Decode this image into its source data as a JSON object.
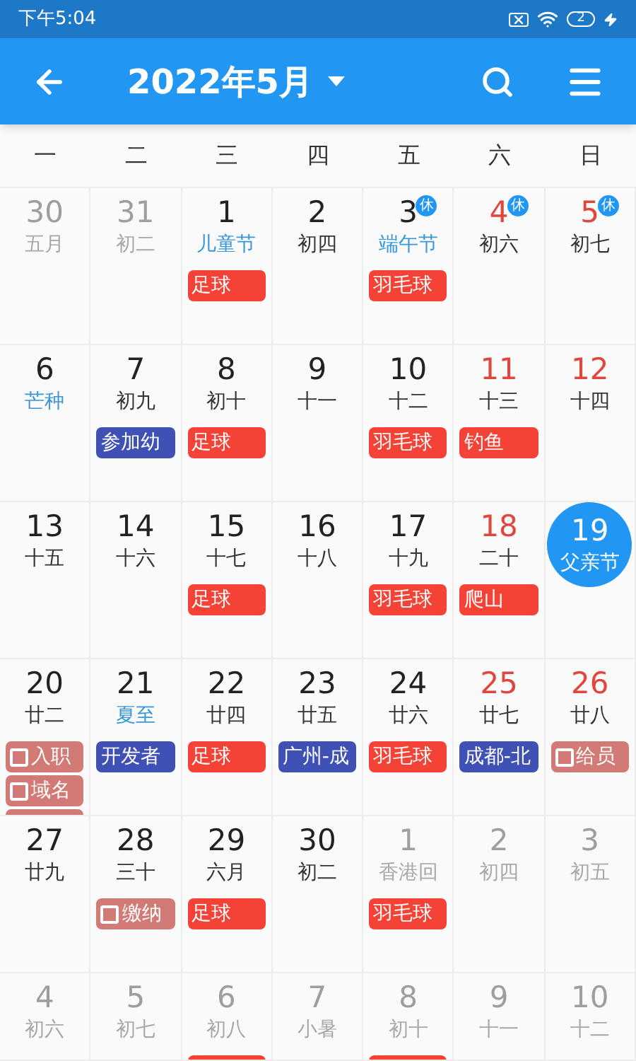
{
  "status_bar": {
    "time": "下午5:04",
    "battery": "2"
  },
  "app_bar": {
    "title": "2022年5月"
  },
  "weekdays": [
    "一",
    "二",
    "三",
    "四",
    "五",
    "六",
    "日"
  ],
  "weeks": [
    [
      {
        "day": "30",
        "lunar": "五月",
        "faded": true,
        "red": false,
        "festival": false,
        "selected": false
      },
      {
        "day": "31",
        "lunar": "初二",
        "faded": true,
        "red": false,
        "festival": false,
        "selected": false
      },
      {
        "day": "1",
        "lunar": "儿童节",
        "faded": false,
        "red": false,
        "festival": true,
        "selected": false,
        "events": [
          {
            "kind": "event",
            "label": "足球",
            "color": "#f44336"
          }
        ]
      },
      {
        "day": "2",
        "lunar": "初四",
        "faded": false,
        "red": false,
        "festival": false,
        "selected": false
      },
      {
        "day": "3",
        "lunar": "端午节",
        "faded": false,
        "red": false,
        "festival": true,
        "rest": "休",
        "selected": false,
        "events": [
          {
            "kind": "event",
            "label": "羽毛球",
            "color": "#f44336"
          }
        ]
      },
      {
        "day": "4",
        "lunar": "初六",
        "faded": false,
        "red": true,
        "festival": false,
        "rest": "休",
        "selected": false
      },
      {
        "day": "5",
        "lunar": "初七",
        "faded": false,
        "red": true,
        "festival": false,
        "rest": "休",
        "selected": false
      }
    ],
    [
      {
        "day": "6",
        "lunar": "芒种",
        "faded": false,
        "red": false,
        "festival": true,
        "selected": false
      },
      {
        "day": "7",
        "lunar": "初九",
        "faded": false,
        "red": false,
        "festival": false,
        "selected": false,
        "events": [
          {
            "kind": "event",
            "label": "参加幼",
            "color": "#3f51b5"
          }
        ]
      },
      {
        "day": "8",
        "lunar": "初十",
        "faded": false,
        "red": false,
        "festival": false,
        "selected": false,
        "events": [
          {
            "kind": "event",
            "label": "足球",
            "color": "#f44336"
          }
        ]
      },
      {
        "day": "9",
        "lunar": "十一",
        "faded": false,
        "red": false,
        "festival": false,
        "selected": false
      },
      {
        "day": "10",
        "lunar": "十二",
        "faded": false,
        "red": false,
        "festival": false,
        "selected": false,
        "events": [
          {
            "kind": "event",
            "label": "羽毛球",
            "color": "#f44336"
          }
        ]
      },
      {
        "day": "11",
        "lunar": "十三",
        "faded": false,
        "red": true,
        "festival": false,
        "selected": false,
        "events": [
          {
            "kind": "event",
            "label": "钓鱼",
            "color": "#f44336"
          }
        ]
      },
      {
        "day": "12",
        "lunar": "十四",
        "faded": false,
        "red": true,
        "festival": false,
        "selected": false
      }
    ],
    [
      {
        "day": "13",
        "lunar": "十五",
        "faded": false,
        "red": false,
        "festival": false,
        "selected": false
      },
      {
        "day": "14",
        "lunar": "十六",
        "faded": false,
        "red": false,
        "festival": false,
        "selected": false
      },
      {
        "day": "15",
        "lunar": "十七",
        "faded": false,
        "red": false,
        "festival": false,
        "selected": false,
        "events": [
          {
            "kind": "event",
            "label": "足球",
            "color": "#f44336"
          }
        ]
      },
      {
        "day": "16",
        "lunar": "十八",
        "faded": false,
        "red": false,
        "festival": false,
        "selected": false
      },
      {
        "day": "17",
        "lunar": "十九",
        "faded": false,
        "red": false,
        "festival": false,
        "selected": false,
        "events": [
          {
            "kind": "event",
            "label": "羽毛球",
            "color": "#f44336"
          }
        ]
      },
      {
        "day": "18",
        "lunar": "二十",
        "faded": false,
        "red": true,
        "festival": false,
        "selected": false,
        "events": [
          {
            "kind": "event",
            "label": "爬山",
            "color": "#f44336"
          }
        ]
      },
      {
        "day": "19",
        "lunar": "父亲节",
        "selected": true
      }
    ],
    [
      {
        "day": "20",
        "lunar": "廿二",
        "faded": false,
        "red": false,
        "festival": false,
        "selected": false,
        "more": true,
        "events": [
          {
            "kind": "todo",
            "label": "入职",
            "color": "#d27b76"
          },
          {
            "kind": "todo",
            "label": "域名",
            "color": "#d27b76"
          }
        ]
      },
      {
        "day": "21",
        "lunar": "夏至",
        "faded": false,
        "red": false,
        "festival": true,
        "selected": false,
        "events": [
          {
            "kind": "event",
            "label": "开发者",
            "color": "#3f51b5"
          }
        ]
      },
      {
        "day": "22",
        "lunar": "廿四",
        "faded": false,
        "red": false,
        "festival": false,
        "selected": false,
        "events": [
          {
            "kind": "event",
            "label": "足球",
            "color": "#f44336"
          }
        ]
      },
      {
        "day": "23",
        "lunar": "廿五",
        "faded": false,
        "red": false,
        "festival": false,
        "selected": false,
        "events": [
          {
            "kind": "event",
            "label": "广州-成",
            "color": "#3f51b5"
          }
        ]
      },
      {
        "day": "24",
        "lunar": "廿六",
        "faded": false,
        "red": false,
        "festival": false,
        "selected": false,
        "events": [
          {
            "kind": "event",
            "label": "羽毛球",
            "color": "#f44336"
          }
        ]
      },
      {
        "day": "25",
        "lunar": "廿七",
        "faded": false,
        "red": true,
        "festival": false,
        "selected": false,
        "events": [
          {
            "kind": "event",
            "label": "成都-北",
            "color": "#3f51b5"
          }
        ]
      },
      {
        "day": "26",
        "lunar": "廿八",
        "faded": false,
        "red": true,
        "festival": false,
        "selected": false,
        "events": [
          {
            "kind": "todo",
            "label": "给员",
            "color": "#d27b76"
          }
        ]
      }
    ],
    [
      {
        "day": "27",
        "lunar": "廿九",
        "faded": false,
        "red": false,
        "festival": false,
        "selected": false
      },
      {
        "day": "28",
        "lunar": "三十",
        "faded": false,
        "red": false,
        "festival": false,
        "selected": false,
        "events": [
          {
            "kind": "todo",
            "label": "缴纳",
            "color": "#d27b76"
          }
        ]
      },
      {
        "day": "29",
        "lunar": "六月",
        "faded": false,
        "red": false,
        "festival": false,
        "selected": false,
        "events": [
          {
            "kind": "event",
            "label": "足球",
            "color": "#f44336"
          }
        ]
      },
      {
        "day": "30",
        "lunar": "初二",
        "faded": false,
        "red": false,
        "festival": false,
        "selected": false
      },
      {
        "day": "1",
        "lunar": "香港回",
        "faded": true,
        "red": false,
        "festival": false,
        "selected": false,
        "events": [
          {
            "kind": "event",
            "label": "羽毛球",
            "color": "#f44336"
          }
        ]
      },
      {
        "day": "2",
        "lunar": "初四",
        "faded": true,
        "red": false,
        "festival": false,
        "selected": false
      },
      {
        "day": "3",
        "lunar": "初五",
        "faded": true,
        "red": false,
        "festival": false,
        "selected": false
      }
    ],
    [
      {
        "day": "4",
        "lunar": "初六",
        "faded": true,
        "red": false,
        "festival": false,
        "selected": false
      },
      {
        "day": "5",
        "lunar": "初七",
        "faded": true,
        "red": false,
        "festival": false,
        "selected": false
      },
      {
        "day": "6",
        "lunar": "初八",
        "faded": true,
        "red": false,
        "festival": false,
        "selected": false,
        "more": true
      },
      {
        "day": "7",
        "lunar": "小暑",
        "faded": true,
        "red": false,
        "festival": false,
        "selected": false
      },
      {
        "day": "8",
        "lunar": "初十",
        "faded": true,
        "red": false,
        "festival": false,
        "selected": false,
        "more": true
      },
      {
        "day": "9",
        "lunar": "十一",
        "faded": true,
        "red": false,
        "festival": false,
        "selected": false
      },
      {
        "day": "10",
        "lunar": "十二",
        "faded": true,
        "red": false,
        "festival": false,
        "selected": false
      }
    ]
  ]
}
